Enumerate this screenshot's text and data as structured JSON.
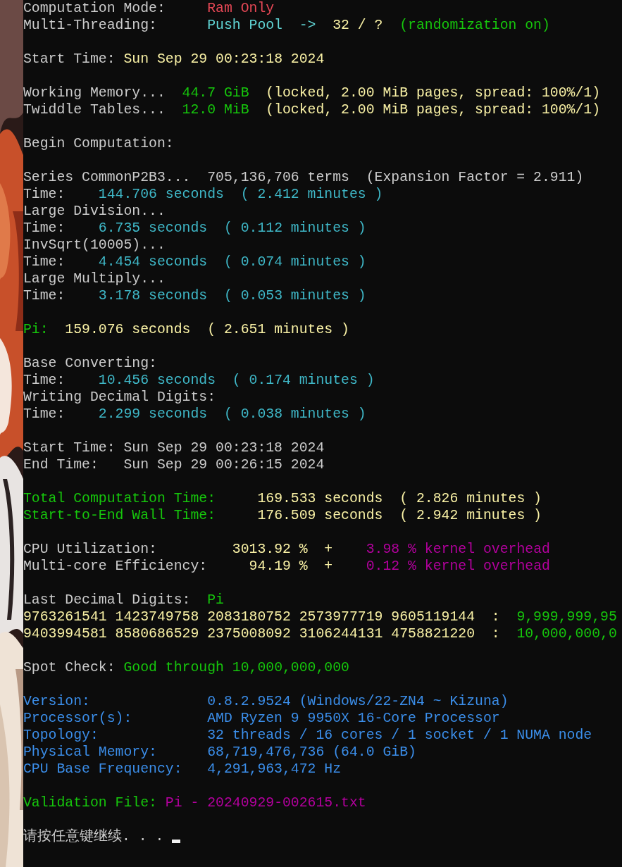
{
  "console": {
    "lines": [
      {
        "kind": "text",
        "segments": [
          {
            "text": "Computation Mode:     ",
            "color": "#cccccc"
          },
          {
            "text": "Ram Only",
            "color": "#e74856"
          }
        ]
      },
      {
        "kind": "text",
        "segments": [
          {
            "text": "Multi-Threading:      ",
            "color": "#cccccc"
          },
          {
            "text": "Push Pool  ->  ",
            "color": "#61d6d6"
          },
          {
            "text": "32 / ?  ",
            "color": "#f9f1a5"
          },
          {
            "text": "(randomization on)",
            "color": "#16c60c"
          }
        ]
      },
      {
        "kind": "blank"
      },
      {
        "kind": "text",
        "segments": [
          {
            "text": "Start Time: ",
            "color": "#cccccc"
          },
          {
            "text": "Sun Sep 29 00:23:18 2024",
            "color": "#f9f1a5"
          }
        ]
      },
      {
        "kind": "blank"
      },
      {
        "kind": "text",
        "segments": [
          {
            "text": "Working Memory...  ",
            "color": "#cccccc"
          },
          {
            "text": "44.7 GiB",
            "color": "#16c60c"
          },
          {
            "text": "  (locked, 2.00 MiB pages, spread: 100%/1)",
            "color": "#f9f1a5"
          }
        ]
      },
      {
        "kind": "text",
        "segments": [
          {
            "text": "Twiddle Tables...  ",
            "color": "#cccccc"
          },
          {
            "text": "12.0 MiB",
            "color": "#16c60c"
          },
          {
            "text": "  (locked, 2.00 MiB pages, spread: 100%/1)",
            "color": "#f9f1a5"
          }
        ]
      },
      {
        "kind": "blank"
      },
      {
        "kind": "text",
        "segments": [
          {
            "text": "Begin Computation:",
            "color": "#cccccc"
          }
        ]
      },
      {
        "kind": "blank"
      },
      {
        "kind": "text",
        "segments": [
          {
            "text": "Series CommonP2B3...  705,136,706 terms  (Expansion Factor = 2.911)",
            "color": "#cccccc"
          }
        ]
      },
      {
        "kind": "text",
        "segments": [
          {
            "text": "Time:    ",
            "color": "#cccccc"
          },
          {
            "text": "144.706 seconds  ( 2.412 minutes )",
            "color": "#3fb8c8"
          }
        ]
      },
      {
        "kind": "text",
        "segments": [
          {
            "text": "Large Division...",
            "color": "#cccccc"
          }
        ]
      },
      {
        "kind": "text",
        "segments": [
          {
            "text": "Time:    ",
            "color": "#cccccc"
          },
          {
            "text": "6.735 seconds  ( 0.112 minutes )",
            "color": "#3fb8c8"
          }
        ]
      },
      {
        "kind": "text",
        "segments": [
          {
            "text": "InvSqrt(10005)...",
            "color": "#cccccc"
          }
        ]
      },
      {
        "kind": "text",
        "segments": [
          {
            "text": "Time:    ",
            "color": "#cccccc"
          },
          {
            "text": "4.454 seconds  ( 0.074 minutes )",
            "color": "#3fb8c8"
          }
        ]
      },
      {
        "kind": "text",
        "segments": [
          {
            "text": "Large Multiply...",
            "color": "#cccccc"
          }
        ]
      },
      {
        "kind": "text",
        "segments": [
          {
            "text": "Time:    ",
            "color": "#cccccc"
          },
          {
            "text": "3.178 seconds  ( 0.053 minutes )",
            "color": "#3fb8c8"
          }
        ]
      },
      {
        "kind": "blank"
      },
      {
        "kind": "text",
        "segments": [
          {
            "text": "Pi:  ",
            "color": "#16c60c"
          },
          {
            "text": "159.076 seconds  ( 2.651 minutes )",
            "color": "#f9f1a5"
          }
        ]
      },
      {
        "kind": "blank"
      },
      {
        "kind": "text",
        "segments": [
          {
            "text": "Base Converting:",
            "color": "#cccccc"
          }
        ]
      },
      {
        "kind": "text",
        "segments": [
          {
            "text": "Time:    ",
            "color": "#cccccc"
          },
          {
            "text": "10.456 seconds  ( 0.174 minutes )",
            "color": "#3fb8c8"
          }
        ]
      },
      {
        "kind": "text",
        "segments": [
          {
            "text": "Writing Decimal Digits:",
            "color": "#cccccc"
          }
        ]
      },
      {
        "kind": "text",
        "segments": [
          {
            "text": "Time:    ",
            "color": "#cccccc"
          },
          {
            "text": "2.299 seconds  ( 0.038 minutes )",
            "color": "#3fb8c8"
          }
        ]
      },
      {
        "kind": "blank"
      },
      {
        "kind": "text",
        "segments": [
          {
            "text": "Start Time: Sun Sep 29 00:23:18 2024",
            "color": "#cccccc"
          }
        ]
      },
      {
        "kind": "text",
        "segments": [
          {
            "text": "End Time:   Sun Sep 29 00:26:15 2024",
            "color": "#cccccc"
          }
        ]
      },
      {
        "kind": "blank"
      },
      {
        "kind": "text",
        "segments": [
          {
            "text": "Total Computation Time:     ",
            "color": "#16c60c"
          },
          {
            "text": "169.533 seconds  ( 2.826 minutes )",
            "color": "#f9f1a5"
          }
        ]
      },
      {
        "kind": "text",
        "segments": [
          {
            "text": "Start-to-End Wall Time:     ",
            "color": "#16c60c"
          },
          {
            "text": "176.509 seconds  ( 2.942 minutes )",
            "color": "#f9f1a5"
          }
        ]
      },
      {
        "kind": "blank"
      },
      {
        "kind": "text",
        "segments": [
          {
            "text": "CPU Utilization:         ",
            "color": "#cccccc"
          },
          {
            "text": "3013.92 %  +    ",
            "color": "#f9f1a5"
          },
          {
            "text": "3.98 % kernel overhead",
            "color": "#b4009e"
          }
        ]
      },
      {
        "kind": "text",
        "segments": [
          {
            "text": "Multi-core Efficiency:     ",
            "color": "#cccccc"
          },
          {
            "text": "94.19 %  +    ",
            "color": "#f9f1a5"
          },
          {
            "text": "0.12 % kernel overhead",
            "color": "#b4009e"
          }
        ]
      },
      {
        "kind": "blank"
      },
      {
        "kind": "text",
        "segments": [
          {
            "text": "Last Decimal Digits:  ",
            "color": "#cccccc"
          },
          {
            "text": "Pi",
            "color": "#16c60c"
          }
        ]
      },
      {
        "kind": "text",
        "segments": [
          {
            "text": "9763261541 1423749758 2083180752 2573977719 9605119144  :  ",
            "color": "#f9f1a5"
          },
          {
            "text": "9,999,999,95",
            "color": "#16c60c"
          }
        ]
      },
      {
        "kind": "text",
        "segments": [
          {
            "text": "9403994581 8580686529 2375008092 3106244131 4758821220  :  ",
            "color": "#f9f1a5"
          },
          {
            "text": "10,000,000,0",
            "color": "#16c60c"
          }
        ]
      },
      {
        "kind": "blank"
      },
      {
        "kind": "text",
        "segments": [
          {
            "text": "Spot Check: ",
            "color": "#cccccc"
          },
          {
            "text": "Good through 10,000,000,000",
            "color": "#16c60c"
          }
        ]
      },
      {
        "kind": "blank"
      },
      {
        "kind": "text",
        "segments": [
          {
            "text": "Version:              ",
            "color": "#3b8eea"
          },
          {
            "text": "0.8.2.9524 (Windows/22-ZN4 ~ Kizuna)",
            "color": "#3b8eea"
          }
        ]
      },
      {
        "kind": "text",
        "segments": [
          {
            "text": "Processor(s):         ",
            "color": "#3b8eea"
          },
          {
            "text": "AMD Ryzen 9 9950X 16-Core Processor",
            "color": "#3b8eea"
          }
        ]
      },
      {
        "kind": "text",
        "segments": [
          {
            "text": "Topology:             ",
            "color": "#3b8eea"
          },
          {
            "text": "32 threads / 16 cores / 1 socket / 1 NUMA node",
            "color": "#3b8eea"
          }
        ]
      },
      {
        "kind": "text",
        "segments": [
          {
            "text": "Physical Memory:      ",
            "color": "#3b8eea"
          },
          {
            "text": "68,719,476,736 (64.0 GiB)",
            "color": "#3b8eea"
          }
        ]
      },
      {
        "kind": "text",
        "segments": [
          {
            "text": "CPU Base Frequency:   ",
            "color": "#3b8eea"
          },
          {
            "text": "4,291,963,472 Hz",
            "color": "#3b8eea"
          }
        ]
      },
      {
        "kind": "blank"
      },
      {
        "kind": "text",
        "segments": [
          {
            "text": "Validation File: ",
            "color": "#16c60c"
          },
          {
            "text": "Pi - 20240929-002615.txt",
            "color": "#b4009e"
          }
        ]
      },
      {
        "kind": "blank"
      },
      {
        "kind": "text",
        "cursor": true,
        "segments": [
          {
            "text": "请按任意键继续. . . ",
            "color": "#cccccc"
          }
        ]
      }
    ]
  }
}
